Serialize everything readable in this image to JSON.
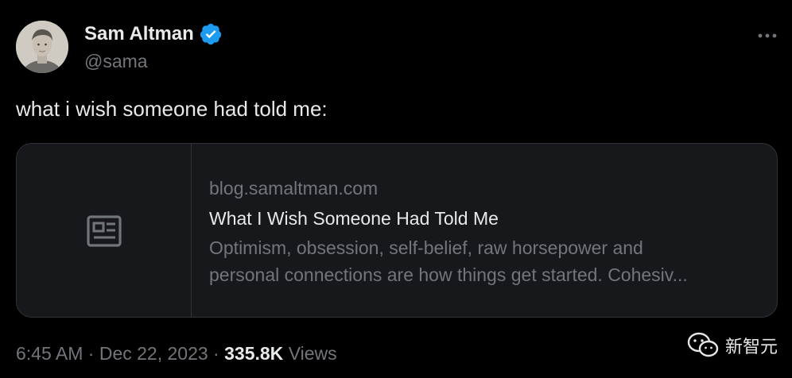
{
  "author": {
    "name": "Sam Altman",
    "handle": "@sama",
    "verified_icon": "verified-badge-icon",
    "verified_color": "#1d9bf0"
  },
  "tweet": {
    "text": "what i wish someone had told me:"
  },
  "link_card": {
    "thumbnail_icon": "news-article-icon",
    "domain": "blog.samaltman.com",
    "title": "What I Wish Someone Had Told Me",
    "description_line1": "Optimism, obsession, self-belief, raw horsepower and",
    "description_line2": "personal connections are how things get started. Cohesiv..."
  },
  "meta": {
    "time": "6:45 AM",
    "separator": " · ",
    "date": "Dec 22, 2023",
    "views_count": "335.8K",
    "views_label": "Views"
  },
  "watermark": {
    "text": "新智元"
  },
  "colors": {
    "background": "#000000",
    "primary_text": "#e7e9ea",
    "secondary_text": "#71767b",
    "border": "#2f3336",
    "card_background": "#16181c"
  }
}
